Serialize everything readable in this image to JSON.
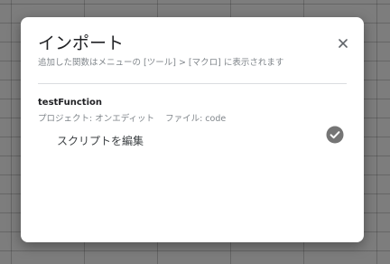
{
  "dialog": {
    "title": "インポート",
    "subtitle": "追加した関数はメニューの [ツール] > [マクロ] に表示されます",
    "close_icon": "close-icon",
    "macro": {
      "name": "testFunction",
      "project_label": "プロジェクト: オンエディット",
      "file_label": "ファイル: code",
      "edit_script_label": "スクリプトを編集",
      "status_icon": "check-circle-icon"
    }
  },
  "colors": {
    "backdrop": "#7d7d7d",
    "dialog_bg": "#ffffff",
    "secondary_text": "#80868b",
    "check_icon": "#757575"
  }
}
